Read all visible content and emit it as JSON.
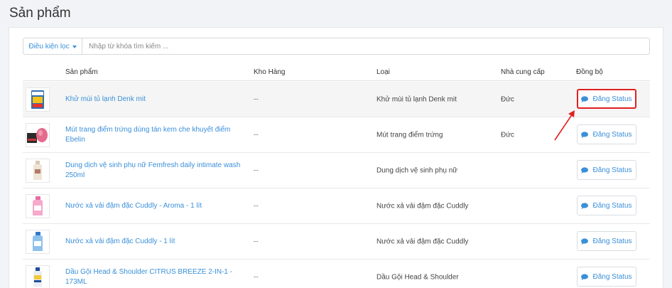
{
  "page": {
    "title": "Sản phẩm"
  },
  "filter": {
    "button_label": "Điều kiện lọc",
    "placeholder": "Nhập từ khóa tìm kiếm ..."
  },
  "table": {
    "headers": {
      "product": "Sản phẩm",
      "stock": "Kho Hàng",
      "type": "Loại",
      "supplier": "Nhà cung cấp",
      "sync": "Đồng bộ"
    },
    "sync_button_label": "Đăng Status",
    "rows": [
      {
        "name": "Khử mùi tủ lạnh Denk mit",
        "stock": "--",
        "type": "Khử mùi tủ lạnh Denk mit",
        "supplier": "Đức",
        "thumb_icon": "fridge-deodorizer-product-icon"
      },
      {
        "name": "Mút trang điểm trứng dùng tán kem che khuyết điểm Ebelin",
        "stock": "--",
        "type": "Mút trang điểm trứng",
        "supplier": "Đức",
        "thumb_icon": "makeup-sponge-product-icon"
      },
      {
        "name": "Dung dịch vệ sinh phụ nữ Femfresh daily intimate wash 250ml",
        "stock": "--",
        "type": "Dung dịch vệ sinh phụ nữ",
        "supplier": "",
        "thumb_icon": "intimate-wash-bottle-icon"
      },
      {
        "name": "Nước xả vải đậm đặc Cuddly - Aroma - 1 lít",
        "stock": "--",
        "type": "Nước xả vải đậm đặc Cuddly",
        "supplier": "",
        "thumb_icon": "pink-softener-bottle-icon"
      },
      {
        "name": "Nước xả vải đậm đặc Cuddly - 1 lít",
        "stock": "--",
        "type": "Nước xả vải đậm đặc Cuddly",
        "supplier": "",
        "thumb_icon": "blue-softener-bottle-icon"
      },
      {
        "name": "Dầu Gội Head & Shoulder CITRUS BREEZE 2-IN-1 - 173ML",
        "stock": "--",
        "type": "Dầu Gội Head & Shoulder",
        "supplier": "",
        "thumb_icon": "shampoo-bottle-icon"
      }
    ]
  },
  "colors": {
    "link": "#3a8fd9",
    "highlight_border": "#e02020",
    "arrow": "#e02020"
  }
}
